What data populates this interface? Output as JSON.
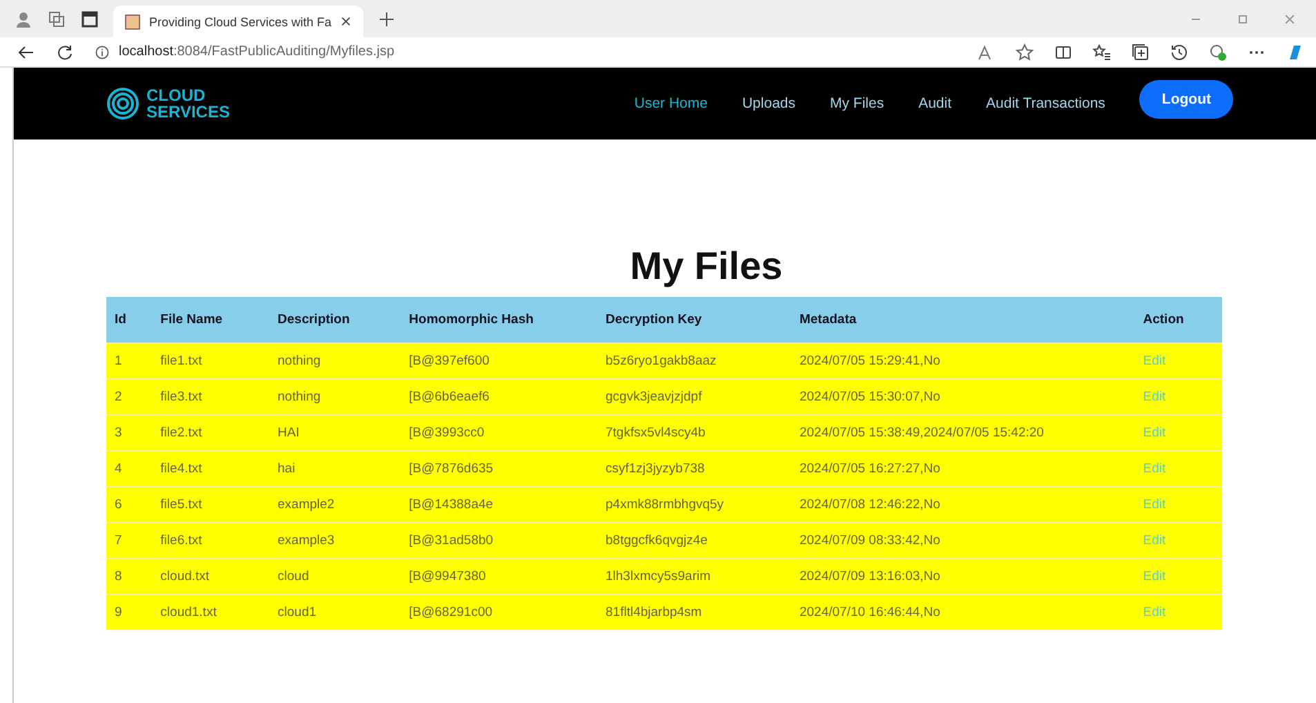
{
  "browser": {
    "tab_title": "Providing Cloud Services with Fa",
    "address": "**localhost**:8084/FastPublicAuditing/Myfiles.jsp"
  },
  "navbar": {
    "logo_text": "CLOUD SERVICES",
    "items": [
      {
        "label": "User Home",
        "selected": true
      },
      {
        "label": "Uploads",
        "selected": false
      },
      {
        "label": "My Files",
        "selected": false
      },
      {
        "label": "Audit",
        "selected": false
      },
      {
        "label": "Audit Transactions",
        "selected": false
      }
    ],
    "logout": "Logout"
  },
  "page_title": "My Files",
  "table": {
    "columns": [
      "Id",
      "File Name",
      "Description",
      "Homomorphic Hash",
      "Decryption Key",
      "Metadata",
      "Action"
    ],
    "rows": [
      [
        "1",
        "file1.txt",
        "nothing",
        "[B@397ef600",
        "b5z6ryo1gakb8aaz",
        "2024/07/05 15:29:41,No",
        "Edit"
      ],
      [
        "2",
        "file3.txt",
        "nothing",
        "[B@6b6eaef6",
        "gcgvk3jeavjzjdpf",
        "2024/07/05 15:30:07,No",
        "Edit"
      ],
      [
        "3",
        "file2.txt",
        "HAI",
        "[B@3993cc0",
        "7tgkfsx5vl4scy4b",
        "2024/07/05 15:38:49,2024/07/05 15:42:20",
        "Edit"
      ],
      [
        "4",
        "file4.txt",
        "hai",
        "[B@7876d635",
        "csyf1zj3jyzyb738",
        "2024/07/05 16:27:27,No",
        "Edit"
      ],
      [
        "6",
        "file5.txt",
        "example2",
        "[B@14388a4e",
        "p4xmk88rmbhgvq5y",
        "2024/07/08 12:46:22,No",
        "Edit"
      ],
      [
        "7",
        "file6.txt",
        "example3",
        "[B@31ad58b0",
        "b8tggcfk6qvgjz4e",
        "2024/07/09 08:33:42,No",
        "Edit"
      ],
      [
        "8",
        "cloud.txt",
        "cloud",
        "[B@9947380",
        "1lh3lxmcy5s9arim",
        "2024/07/09 13:16:03,No",
        "Edit"
      ],
      [
        "9",
        "cloud1.txt",
        "cloud1",
        "[B@68291c00",
        "81fltl4bjarbp4sm",
        "2024/07/10 16:46:44,No",
        "Edit"
      ]
    ]
  }
}
